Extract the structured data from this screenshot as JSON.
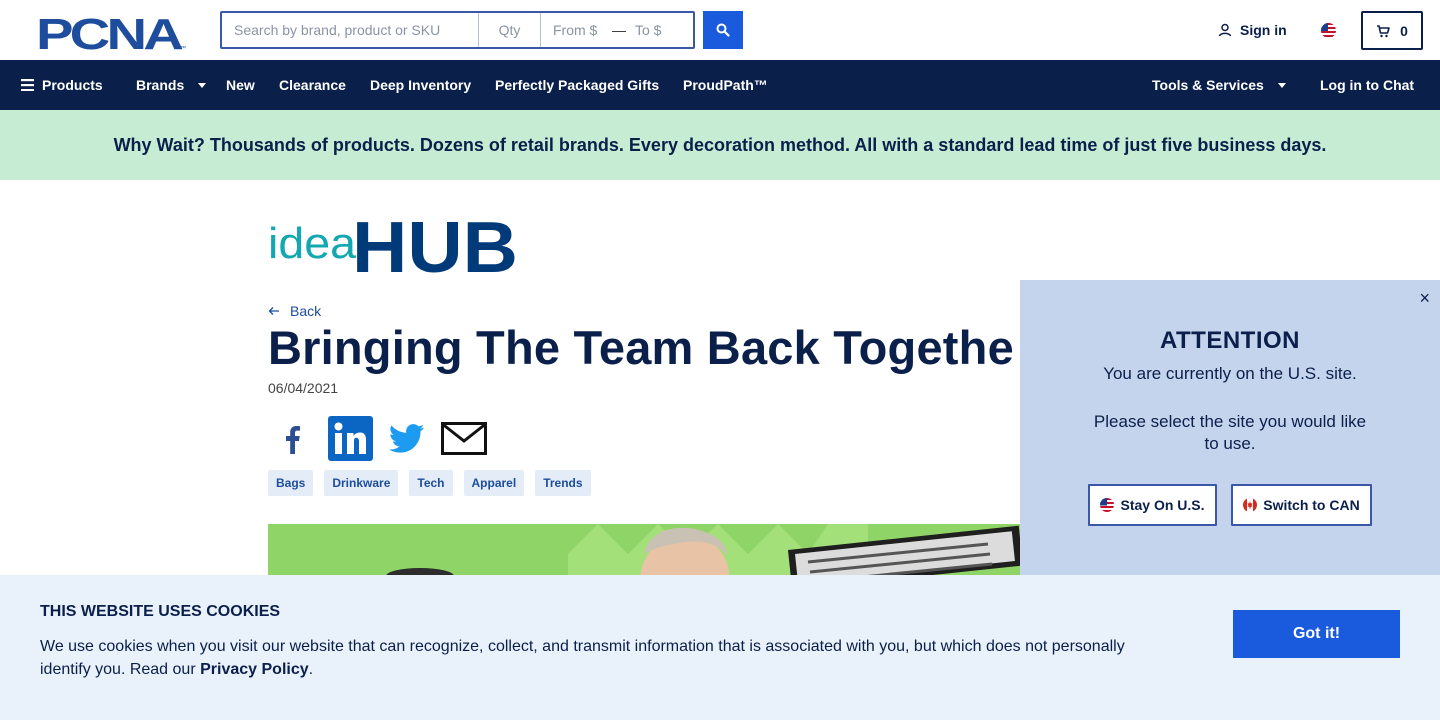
{
  "header": {
    "logo_text": "PCNA",
    "search": {
      "main_placeholder": "Search by brand, product or SKU",
      "qty_placeholder": "Qty",
      "from_placeholder": "From $",
      "range_separator": "—",
      "to_placeholder": "To $"
    },
    "signin_label": "Sign in",
    "cart_count": "0"
  },
  "nav": {
    "items": [
      {
        "label": "Products"
      },
      {
        "label": "Brands"
      },
      {
        "label": "New"
      },
      {
        "label": "Clearance"
      },
      {
        "label": "Deep Inventory"
      },
      {
        "label": "Perfectly Packaged Gifts"
      },
      {
        "label": "ProudPath™"
      },
      {
        "label": "Tools & Services"
      },
      {
        "label": "Log in to Chat"
      }
    ]
  },
  "promo": {
    "text": "Why Wait? Thousands of products. Dozens of retail brands. Every decoration method. All with a standard lead time of just five business days."
  },
  "article": {
    "brand_idea": "idea",
    "brand_hub": "HUB",
    "back_label": "Back",
    "title": "Bringing The Team Back Togethe",
    "date": "06/04/2021",
    "tags": [
      "Bags",
      "Drinkware",
      "Tech",
      "Apparel",
      "Trends"
    ]
  },
  "attention": {
    "close_glyph": "×",
    "title": "ATTENTION",
    "line1": "You are currently on the U.S. site.",
    "line2": "Please select the site you would like to use.",
    "stay_label": "Stay On U.S.",
    "switch_label": "Switch to CAN"
  },
  "cookie": {
    "title": "THIS WEBSITE USES COOKIES",
    "text": "We use cookies when you visit our website that can recognize, collect, and transmit information that is associated with you, but which does not personally identify you. Read our",
    "link_label": "Privacy Policy",
    "suffix": ".",
    "button_label": "Got it!"
  },
  "colors": {
    "navy": "#0b1f4b",
    "accent_blue": "#1a5adc",
    "promo_bg": "#c6edd4",
    "modal_bg": "#c4d4ec",
    "cookie_bg": "#e9f1fb",
    "idea_teal": "#12a7b1",
    "hub_navy": "#003a78"
  }
}
